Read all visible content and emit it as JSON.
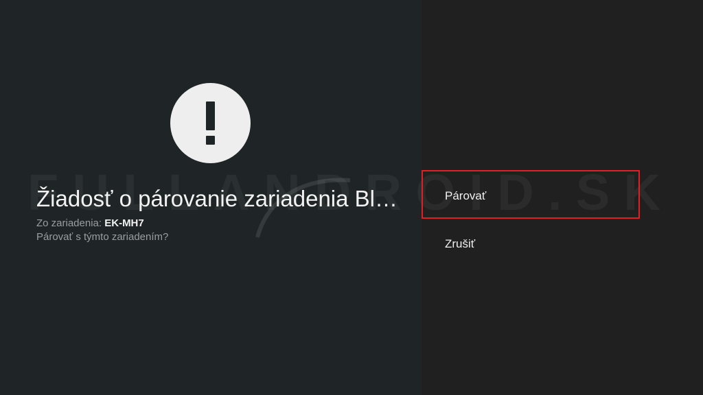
{
  "dialog": {
    "icon": "alert-exclamation-icon",
    "title": "Žiadosť o párovanie zariadenia Bl…",
    "from_label": "Zo zariadenia: ",
    "device_name": "EK-MH7",
    "question": "Párovať s týmto zariadením?"
  },
  "actions": {
    "pair_label": "Párovať",
    "cancel_label": "Zrušiť"
  },
  "watermark": {
    "text": "FULLANDROID.SK"
  },
  "colors": {
    "left_background": "#1f2526",
    "right_background": "#202020",
    "focus_outline": "#e01f26",
    "icon_circle": "#eeeeee"
  }
}
